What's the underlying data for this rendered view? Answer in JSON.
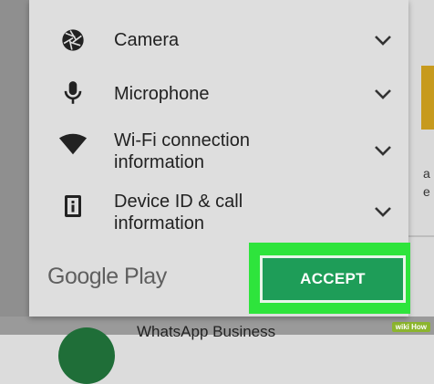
{
  "permissions": [
    {
      "icon": "camera-icon",
      "label": "Camera"
    },
    {
      "icon": "microphone-icon",
      "label": "Microphone"
    },
    {
      "icon": "wifi-icon",
      "label_line1": "Wi-Fi connection",
      "label_line2": "information"
    },
    {
      "icon": "device-id-icon",
      "label_line1": "Device ID & call",
      "label_line2": "information"
    }
  ],
  "footer": {
    "logo": "Google Play",
    "accept_label": "ACCEPT"
  },
  "background": {
    "app_name": "WhatsApp Business",
    "partial_text": "a e",
    "watermark": "wiki How"
  },
  "colors": {
    "accept": "#1e9d58",
    "highlight": "#2ee43c"
  }
}
